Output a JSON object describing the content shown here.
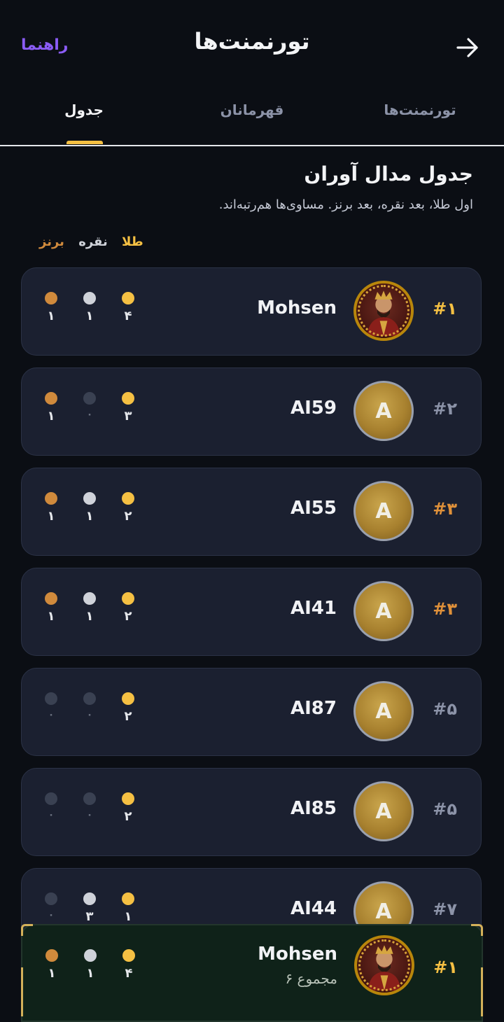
{
  "header": {
    "guide_label": "راهنما",
    "title": "تورنمنت‌ها"
  },
  "tabs": [
    {
      "label": "تورنمنت‌ها",
      "active": false
    },
    {
      "label": "قهرمانان",
      "active": false
    },
    {
      "label": "جدول",
      "active": true
    }
  ],
  "section": {
    "title": "جدول مدال آوران",
    "subtitle": "اول طلا، بعد نقره، بعد برنز. مساوی‌ها هم‌رتبه‌اند."
  },
  "legend": {
    "gold": "طلا",
    "silver": "نقره",
    "bronze": "برنز"
  },
  "colors": {
    "gold": "#f5c043",
    "silver": "#cfd2d9",
    "bronze": "#d08a3c",
    "empty": "#3a4152",
    "rank_top": "#f5c043",
    "rank_orange": "#e0913a",
    "rank_muted": "#8c93a8",
    "accent": "#8b5cf6"
  },
  "rows": [
    {
      "rank": "#۱",
      "rank_style": "top",
      "name": "Mohsen",
      "avatar": "portrait",
      "avatar_letter": "",
      "gold": "۴",
      "silver": "۱",
      "bronze": "۱",
      "gold_n": 4,
      "silver_n": 1,
      "bronze_n": 1
    },
    {
      "rank": "#۲",
      "rank_style": "muted",
      "name": "AI59",
      "avatar": "letter",
      "avatar_letter": "A",
      "gold": "۳",
      "silver": "۰",
      "bronze": "۱",
      "gold_n": 3,
      "silver_n": 0,
      "bronze_n": 1
    },
    {
      "rank": "#۳",
      "rank_style": "orange",
      "name": "AI55",
      "avatar": "letter",
      "avatar_letter": "A",
      "gold": "۲",
      "silver": "۱",
      "bronze": "۱",
      "gold_n": 2,
      "silver_n": 1,
      "bronze_n": 1
    },
    {
      "rank": "#۳",
      "rank_style": "orange",
      "name": "AI41",
      "avatar": "letter",
      "avatar_letter": "A",
      "gold": "۲",
      "silver": "۱",
      "bronze": "۱",
      "gold_n": 2,
      "silver_n": 1,
      "bronze_n": 1
    },
    {
      "rank": "#۵",
      "rank_style": "muted",
      "name": "AI87",
      "avatar": "letter",
      "avatar_letter": "A",
      "gold": "۲",
      "silver": "۰",
      "bronze": "۰",
      "gold_n": 2,
      "silver_n": 0,
      "bronze_n": 0
    },
    {
      "rank": "#۵",
      "rank_style": "muted",
      "name": "AI85",
      "avatar": "letter",
      "avatar_letter": "A",
      "gold": "۲",
      "silver": "۰",
      "bronze": "۰",
      "gold_n": 2,
      "silver_n": 0,
      "bronze_n": 0
    },
    {
      "rank": "#۷",
      "rank_style": "muted",
      "name": "AI44",
      "avatar": "letter",
      "avatar_letter": "A",
      "gold": "۱",
      "silver": "۳",
      "bronze": "۰",
      "gold_n": 1,
      "silver_n": 3,
      "bronze_n": 0
    }
  ],
  "my_row": {
    "rank": "#۱",
    "name": "Mohsen",
    "total": "مجموع ۶",
    "gold": "۴",
    "silver": "۱",
    "bronze": "۱",
    "gold_n": 4,
    "silver_n": 1,
    "bronze_n": 1
  }
}
